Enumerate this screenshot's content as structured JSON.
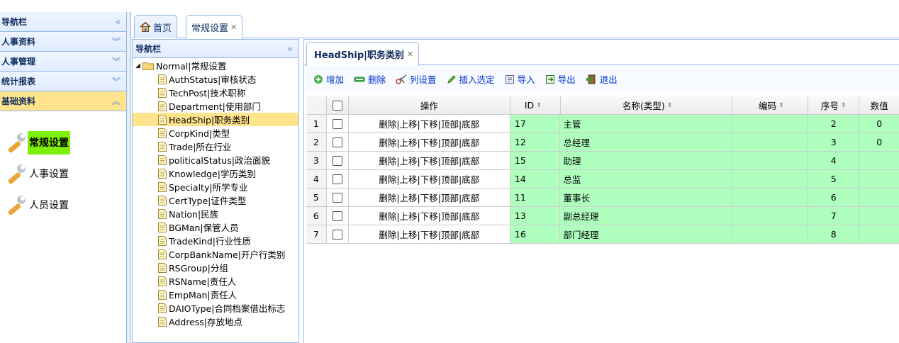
{
  "left_nav": {
    "title": "导航栏",
    "sections": [
      {
        "label": "人事资料"
      },
      {
        "label": "人事管理"
      },
      {
        "label": "统计报表"
      },
      {
        "label": "基础资料"
      }
    ],
    "items": [
      {
        "label": "常规设置"
      },
      {
        "label": "人事设置"
      },
      {
        "label": "人员设置"
      }
    ]
  },
  "outer_tabs": [
    {
      "label": "首页"
    },
    {
      "label": "常规设置"
    }
  ],
  "tree": {
    "title": "导航栏",
    "root": "Normal|常规设置",
    "nodes": [
      "AuthStatus|审核状态",
      "TechPost|技术职称",
      "Department|使用部门",
      "HeadShip|职务类别",
      "CorpKind|类型",
      "Trade|所在行业",
      "politicalStatus|政治面貌",
      "Knowledge|学历类别",
      "Specialty|所学专业",
      "CertType|证件类型",
      "Nation|民族",
      "BGMan|保管人员",
      "TradeKind|行业性质",
      "CorpBankName|开户行类别",
      "RSGroup|分组",
      "RSName|责任人",
      "EmpMan|责任人",
      "DAIOType|合同档案借出标志",
      "Address|存放地点"
    ]
  },
  "inner_tab": {
    "label": "HeadShip|职务类别"
  },
  "toolbar": {
    "add": "增加",
    "delete": "删除",
    "columns": "列设置",
    "insert": "插入选定",
    "import": "导入",
    "export": "导出",
    "exit": "退出"
  },
  "grid": {
    "headers": {
      "op": "操作",
      "id": "ID",
      "name": "名称(类型)",
      "code": "编码",
      "seq": "序号",
      "val": "数值"
    },
    "op_text": "删除|上移|下移|顶部|底部",
    "rows": [
      {
        "n": "1",
        "id": "17",
        "name": "主管",
        "code": "",
        "seq": "2",
        "val": "0"
      },
      {
        "n": "2",
        "id": "12",
        "name": "总经理",
        "code": "",
        "seq": "3",
        "val": "0"
      },
      {
        "n": "3",
        "id": "15",
        "name": "助理",
        "code": "",
        "seq": "4",
        "val": ""
      },
      {
        "n": "4",
        "id": "14",
        "name": "总监",
        "code": "",
        "seq": "5",
        "val": ""
      },
      {
        "n": "5",
        "id": "11",
        "name": "董事长",
        "code": "",
        "seq": "6",
        "val": ""
      },
      {
        "n": "6",
        "id": "13",
        "name": "副总经理",
        "code": "",
        "seq": "7",
        "val": ""
      },
      {
        "n": "7",
        "id": "16",
        "name": "部门经理",
        "code": "",
        "seq": "8",
        "val": ""
      }
    ]
  },
  "colors": {
    "border": "#95b8e7",
    "selected": "#ffe48d",
    "row_highlight": "#afffbf",
    "left_selected": "#7ff007",
    "link": "#0033cc"
  }
}
